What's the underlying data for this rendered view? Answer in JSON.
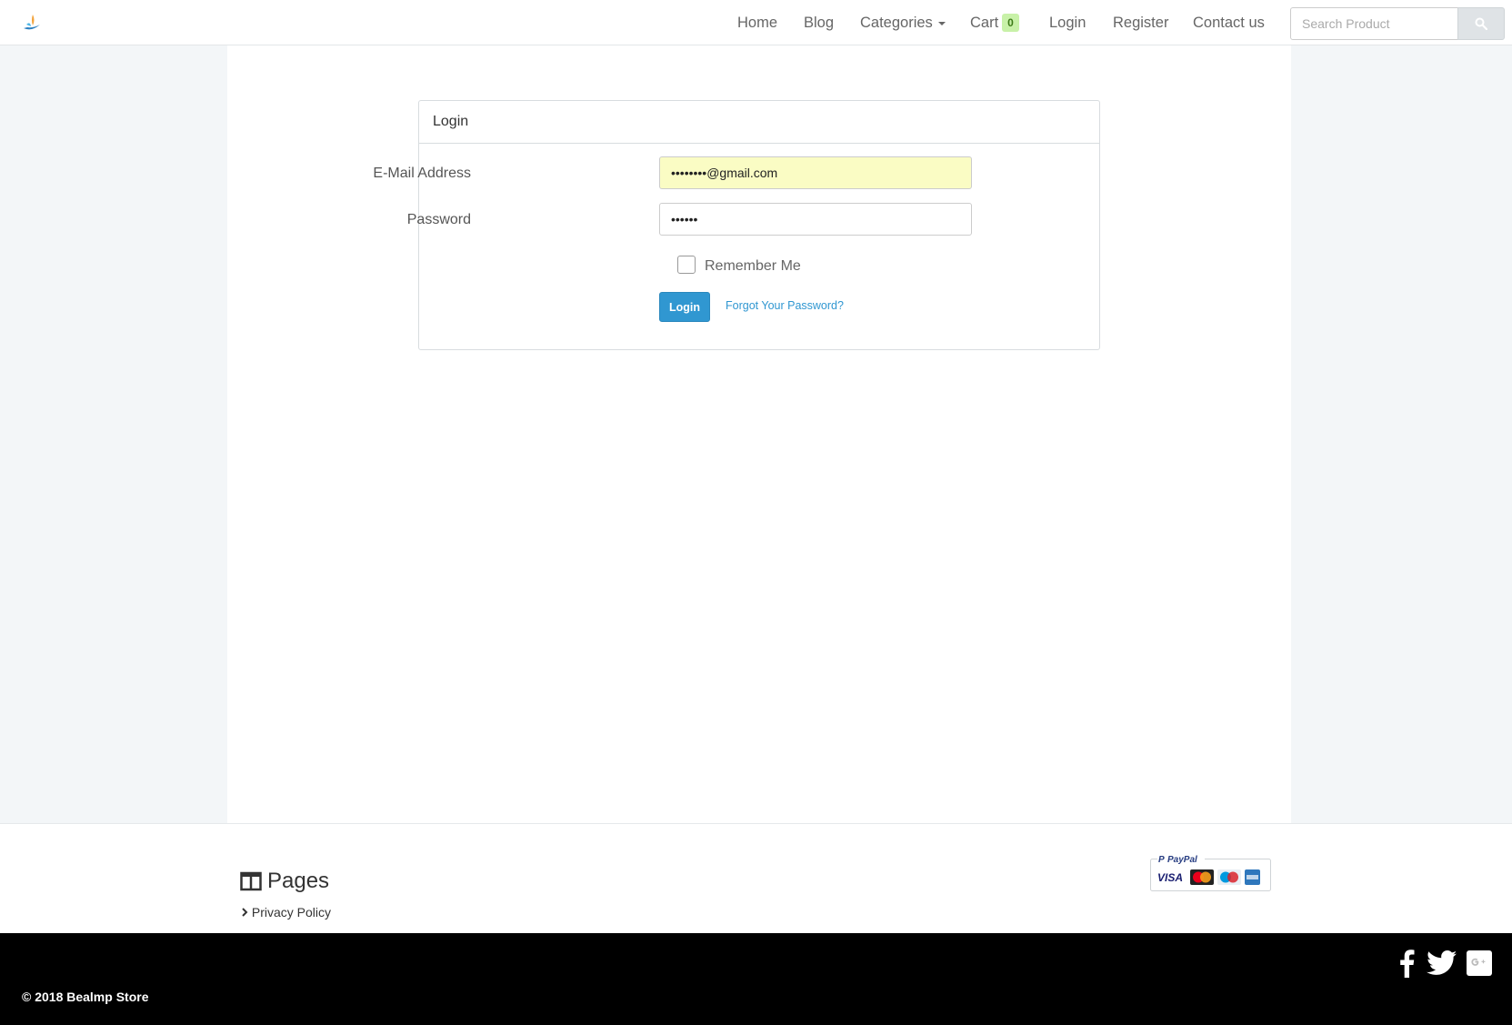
{
  "nav": {
    "home": "Home",
    "blog": "Blog",
    "categories": "Categories",
    "cart": "Cart",
    "cart_count": "0",
    "login": "Login",
    "register": "Register",
    "contact": "Contact us",
    "search_placeholder": "Search Product"
  },
  "login_panel": {
    "heading": "Login",
    "email_label": "E-Mail Address",
    "email_value": "••••••••@gmail.com",
    "password_label": "Password",
    "password_value": "••••••",
    "remember_label": "Remember Me",
    "remember_checked": false,
    "submit_label": "Login",
    "forgot_label": "Forgot Your Password?"
  },
  "footer": {
    "pages_title": "Pages",
    "links": [
      "Privacy Policy"
    ],
    "copyright": "© 2018 Bealmp Store",
    "payment": {
      "brand": "PayPal",
      "cards": [
        "VISA",
        "MasterCard",
        "Maestro",
        "AMEX"
      ]
    },
    "social_icons": [
      "facebook-icon",
      "twitter-icon",
      "google-plus-icon"
    ]
  },
  "colors": {
    "primary": "#3097d1",
    "badge_bg": "#c8f1a8",
    "autofill_bg": "#fafcc4",
    "footer_bg": "#000000"
  }
}
